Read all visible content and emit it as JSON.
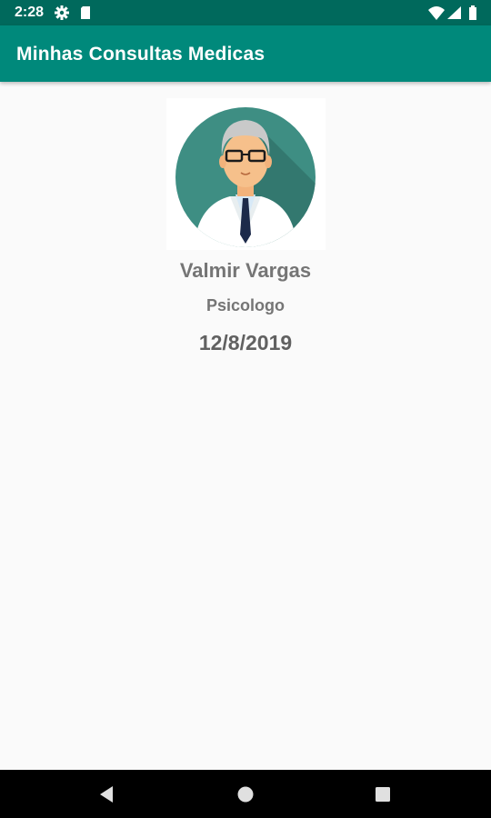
{
  "status_bar": {
    "time": "2:28",
    "icons": [
      "gear-icon",
      "sd-card-icon",
      "wifi-icon",
      "signal-icon",
      "battery-icon"
    ]
  },
  "app_bar": {
    "title": "Minhas Consultas Medicas",
    "color": "#00897b"
  },
  "appointment": {
    "avatar": "doctor-avatar",
    "doctor_name": "Valmir Vargas",
    "specialty": "Psicologo",
    "date": "12/8/2019"
  },
  "nav_bar": {
    "buttons": [
      "back-icon",
      "home-icon",
      "recents-icon"
    ]
  },
  "colors": {
    "status_bar": "#00695c",
    "app_bar": "#00897b",
    "text": "#757575",
    "avatar_circle": "#3e8e83"
  }
}
